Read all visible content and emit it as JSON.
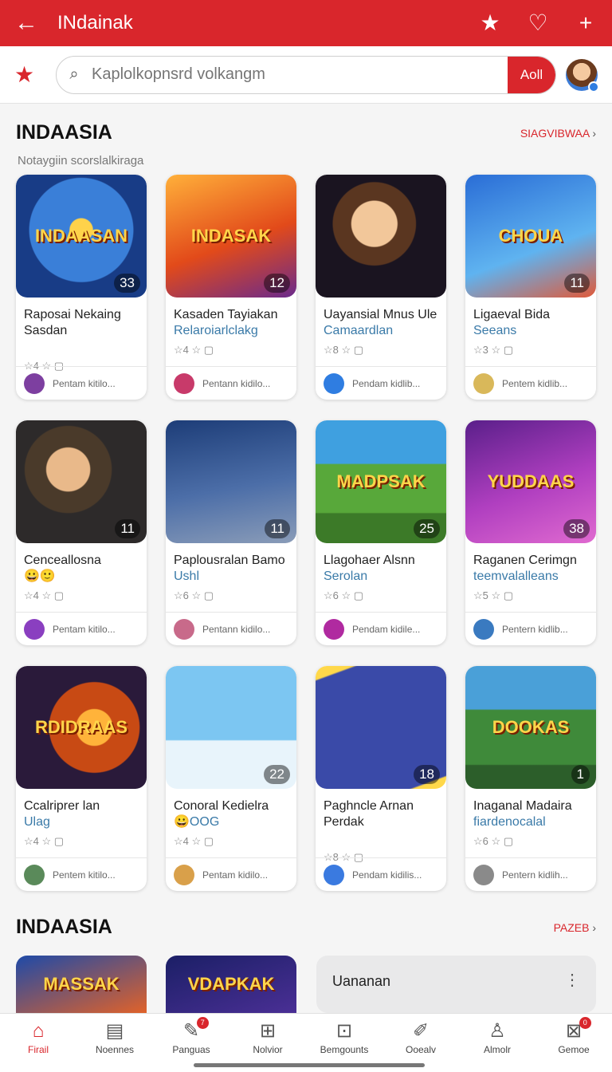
{
  "header": {
    "title": "INdainak"
  },
  "search": {
    "placeholder": "Kaplolkopnsrd volkangm",
    "button_label": "Aoll"
  },
  "section1": {
    "title": "INDAASIA",
    "more_label": "SIAGVIBWAA",
    "subtitle": "Notaygiin scorslalkiraga"
  },
  "section2": {
    "title": "INDAASIA",
    "more_label": "PAZEB"
  },
  "cards": [
    {
      "art": "INDAASAN",
      "count": "33",
      "name": "Raposai Nekaing Sasdan",
      "sub": "",
      "footer": "Pentam kitilo...",
      "icons": "☆4 ☆ ▢"
    },
    {
      "art": "INDASAK",
      "count": "12",
      "name": "Kasaden Tayiakan",
      "sub": "Relaroiarlclakg",
      "footer": "Pentann kidilo...",
      "icons": "☆4 ☆ ▢"
    },
    {
      "art": "",
      "count": "",
      "name": "Uayansial Mnus Ule",
      "sub": "Camaardlan",
      "footer": "Pendam kidlib...",
      "icons": "☆8 ☆ ▢"
    },
    {
      "art": "CHOUA",
      "count": "11",
      "name": "Ligaeval Bida",
      "sub": "Seeans",
      "footer": "Pentem kidlib...",
      "icons": "☆3 ☆ ▢"
    },
    {
      "art": "",
      "count": "11",
      "name": "Cenceallosna",
      "sub": "😀🙂",
      "footer": "Pentam kitilo...",
      "icons": "☆4 ☆ ▢"
    },
    {
      "art": "",
      "count": "11",
      "name": "Paplousralan Bamo",
      "sub": "Ushl",
      "footer": "Pentann kidilo...",
      "icons": "☆6 ☆ ▢"
    },
    {
      "art": "MADPSAK",
      "count": "25",
      "name": "Llagohaer Alsnn",
      "sub": "Serolan",
      "footer": "Pendam kidile...",
      "icons": "☆6 ☆ ▢"
    },
    {
      "art": "YUDDAAS",
      "count": "38",
      "name": "Raganen Cerimgn",
      "sub": "teemvalalleans",
      "footer": "Pentern kidlib...",
      "icons": "☆5 ☆ ▢"
    },
    {
      "art": "RDIDRAAS",
      "count": "",
      "name": "Ccalriprer lan",
      "sub": "Ulag",
      "footer": "Pentem kitilo...",
      "icons": "☆4 ☆ ▢"
    },
    {
      "art": "",
      "count": "22",
      "name": "Conoral Kedielra",
      "sub": "😀OOG",
      "footer": "Pentam kidilo...",
      "icons": "☆4 ☆ ▢"
    },
    {
      "art": "",
      "count": "18",
      "name": "Paghncle Arnan Perdak",
      "sub": "",
      "footer": "Pendam kidilis...",
      "icons": "☆8 ☆ ▢"
    },
    {
      "art": "DOOKAS",
      "count": "1",
      "name": "Inaganal Madaira",
      "sub": "fiardenocalal",
      "footer": "Pentern kidlih...",
      "icons": "☆6 ☆ ▢"
    }
  ],
  "partials": [
    {
      "art": "MASSAK"
    },
    {
      "art": "VDAPKAK"
    }
  ],
  "widget": {
    "title": "Uananan"
  },
  "nav": [
    {
      "label": "Firail",
      "icon": "home-icon",
      "glyph": "⌂",
      "badge": ""
    },
    {
      "label": "Noennes",
      "icon": "news-icon",
      "glyph": "▤",
      "badge": ""
    },
    {
      "label": "Panguas",
      "icon": "games-icon",
      "glyph": "✎",
      "badge": "7"
    },
    {
      "label": "Nolvior",
      "icon": "grid-icon",
      "glyph": "⊞",
      "badge": ""
    },
    {
      "label": "Bemgounts",
      "icon": "camera-icon",
      "glyph": "⊡",
      "badge": ""
    },
    {
      "label": "Ooealv",
      "icon": "edit-icon",
      "glyph": "✐",
      "badge": ""
    },
    {
      "label": "Almolr",
      "icon": "profile-icon",
      "glyph": "♙",
      "badge": ""
    },
    {
      "label": "Gemoe",
      "icon": "gift-icon",
      "glyph": "⊠",
      "badge": "0"
    }
  ],
  "colors": {
    "accent": "#d9262c",
    "link": "#3a7aa8"
  }
}
